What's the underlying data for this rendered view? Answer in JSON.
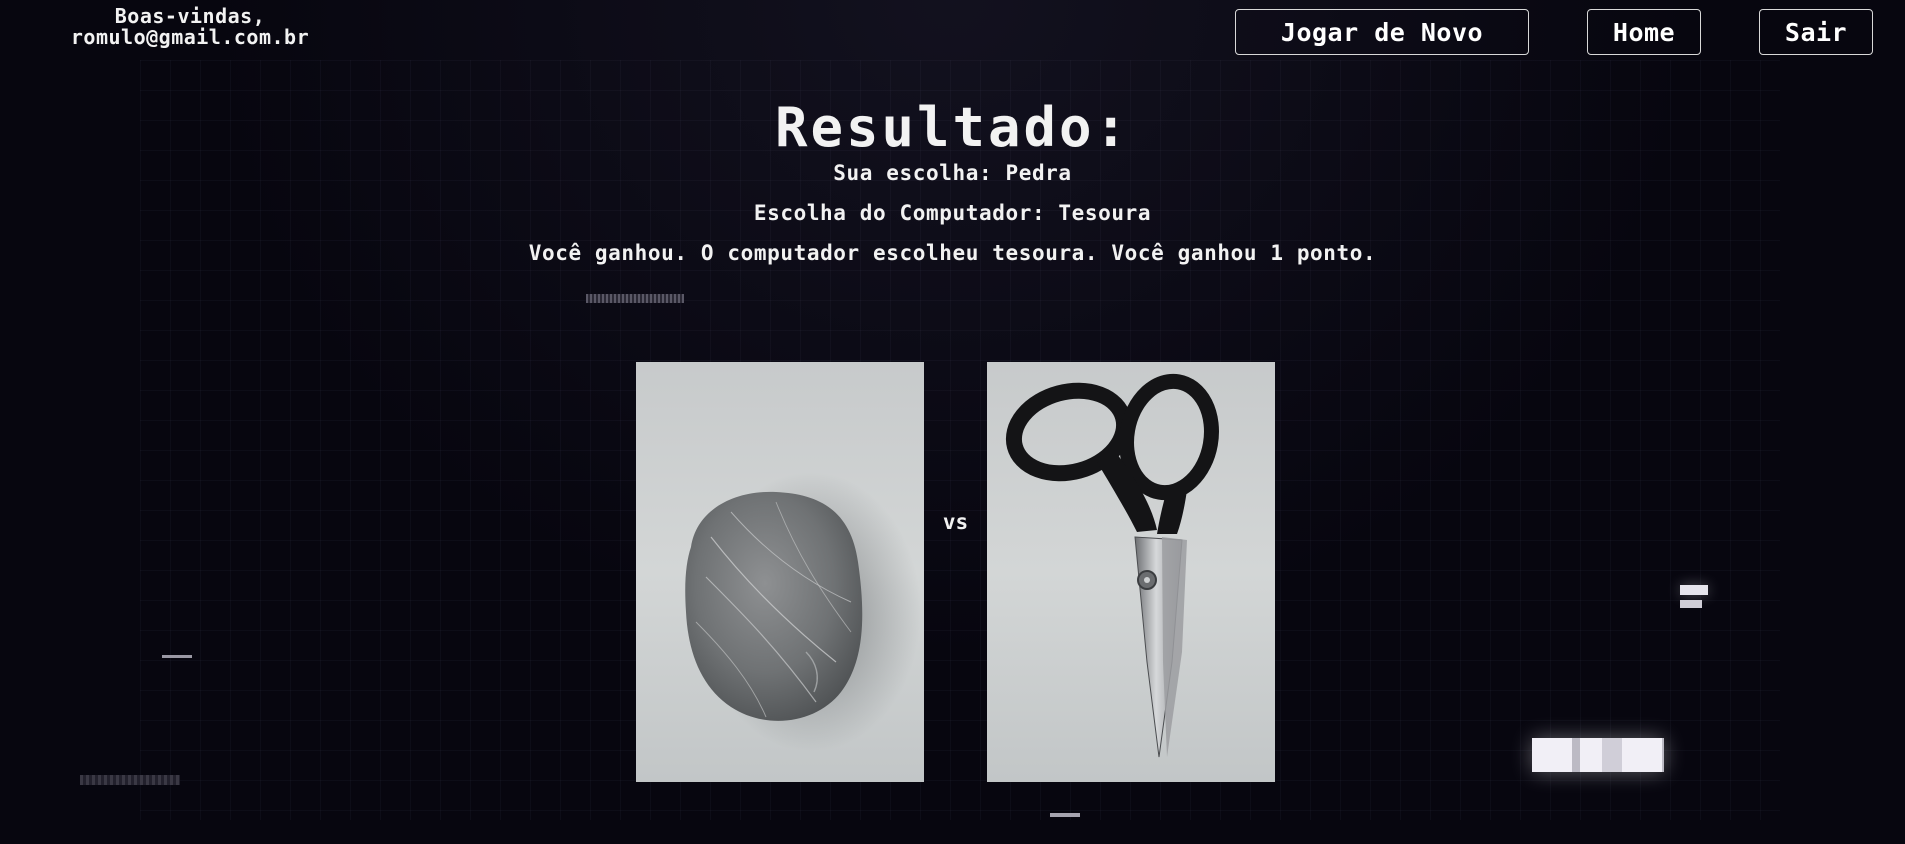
{
  "header": {
    "greeting_line1": "Boas-vindas,",
    "greeting_line2": "romulo@gmail.com.br",
    "buttons": {
      "play_again": "Jogar de Novo",
      "home": "Home",
      "exit": "Sair"
    }
  },
  "result": {
    "title": "Resultado:",
    "user_choice": "Sua escolha: Pedra",
    "computer_choice": "Escolha do Computador: Tesoura",
    "message": "Você ganhou. O computador escolheu tesoura. Você ganhou 1 ponto."
  },
  "versus": {
    "label": "vs",
    "user_image": "stone-image",
    "computer_image": "scissors-image"
  },
  "colors": {
    "background": "#07060f",
    "text": "#f2f2f2",
    "button_border": "#d8d8d8"
  }
}
